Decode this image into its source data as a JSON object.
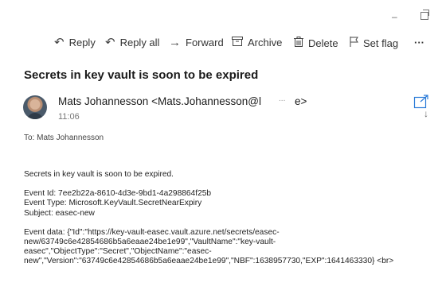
{
  "window": {
    "minimize_label": "–",
    "restore_icon": "restore-icon"
  },
  "toolbar": {
    "reply": "Reply",
    "reply_all": "Reply all",
    "forward": "Forward",
    "archive": "Archive",
    "delete": "Delete",
    "set_flag": "Set flag",
    "more": "···"
  },
  "message": {
    "subject": "Secrets in key vault is soon to be expired",
    "sender_name": "Mats Johannesson",
    "sender_email_prefix": "<Mats.Johannesson@l",
    "sender_email_suffix": "e>",
    "redaction_dots": "...",
    "time": "11:06",
    "to_label": "To:",
    "to_value": "Mats Johannesson"
  },
  "body": {
    "line1": "Secrets in key vault is soon to be expired.",
    "event_id": "Event Id: 7ee2b22a-8610-4d3e-9bd1-4a298864f25b",
    "event_type": "Event Type: Microsoft.KeyVault.SecretNearExpiry",
    "subject_line": "Subject: easec-new",
    "event_data_1": "Event data: {\"Id\":\"https://key-vault-easec.vault.azure.net/secrets/easec-",
    "event_data_2": "new/63749c6e42854686b5a6eaae24be1e99\",\"VaultName\":\"key-vault-",
    "event_data_3": "easec\",\"ObjectType\":\"Secret\",\"ObjectName\":\"easec-",
    "event_data_4": "new\",\"Version\":\"63749c6e42854686b5a6eaae24be1e99\",\"NBF\":1638957730,\"EXP\":1641463330} <br>"
  }
}
